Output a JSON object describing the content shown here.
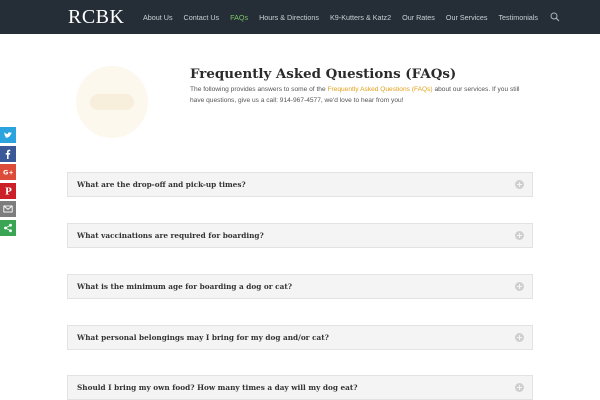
{
  "header": {
    "logo": "RCBK",
    "nav": [
      {
        "label": "About Us"
      },
      {
        "label": "Contact Us"
      },
      {
        "label": "FAQs",
        "active": true
      },
      {
        "label": "Hours & Directions"
      },
      {
        "label": "K9-Kutters & Katz2"
      },
      {
        "label": "Our Rates"
      },
      {
        "label": "Our Services"
      },
      {
        "label": "Testimonials"
      }
    ],
    "search_icon": "search-icon"
  },
  "intro": {
    "title": "Frequently Asked Questions (FAQs)",
    "text_before": "The following provides answers to some of the ",
    "link": "Frequently Asked Questions (FAQs)",
    "text_after": " about our services.  If you still have questions, give us a call: 914-967-4577,  we'd love to hear from you!"
  },
  "social": [
    {
      "name": "twitter",
      "icon": "twitter-icon",
      "color": "#2ba3de"
    },
    {
      "name": "facebook",
      "icon": "facebook-icon",
      "color": "#3b5998"
    },
    {
      "name": "google-plus",
      "icon": "google-plus-icon",
      "color": "#dd4b39"
    },
    {
      "name": "pinterest",
      "icon": "pinterest-icon",
      "color": "#cb2027"
    },
    {
      "name": "email",
      "icon": "email-icon",
      "color": "#7d7d7d"
    },
    {
      "name": "more",
      "icon": "share-icon",
      "color": "#3aa655"
    }
  ],
  "faqs": [
    {
      "question": "What are the drop-off and pick-up times?"
    },
    {
      "question": "What vaccinations are required for boarding?"
    },
    {
      "question": "What is the minimum age for boarding a dog or cat?"
    },
    {
      "question": "What personal belongings may I bring for my dog and/or cat?"
    },
    {
      "question": "Should I bring my own food? How many times a day will my dog eat?"
    }
  ]
}
